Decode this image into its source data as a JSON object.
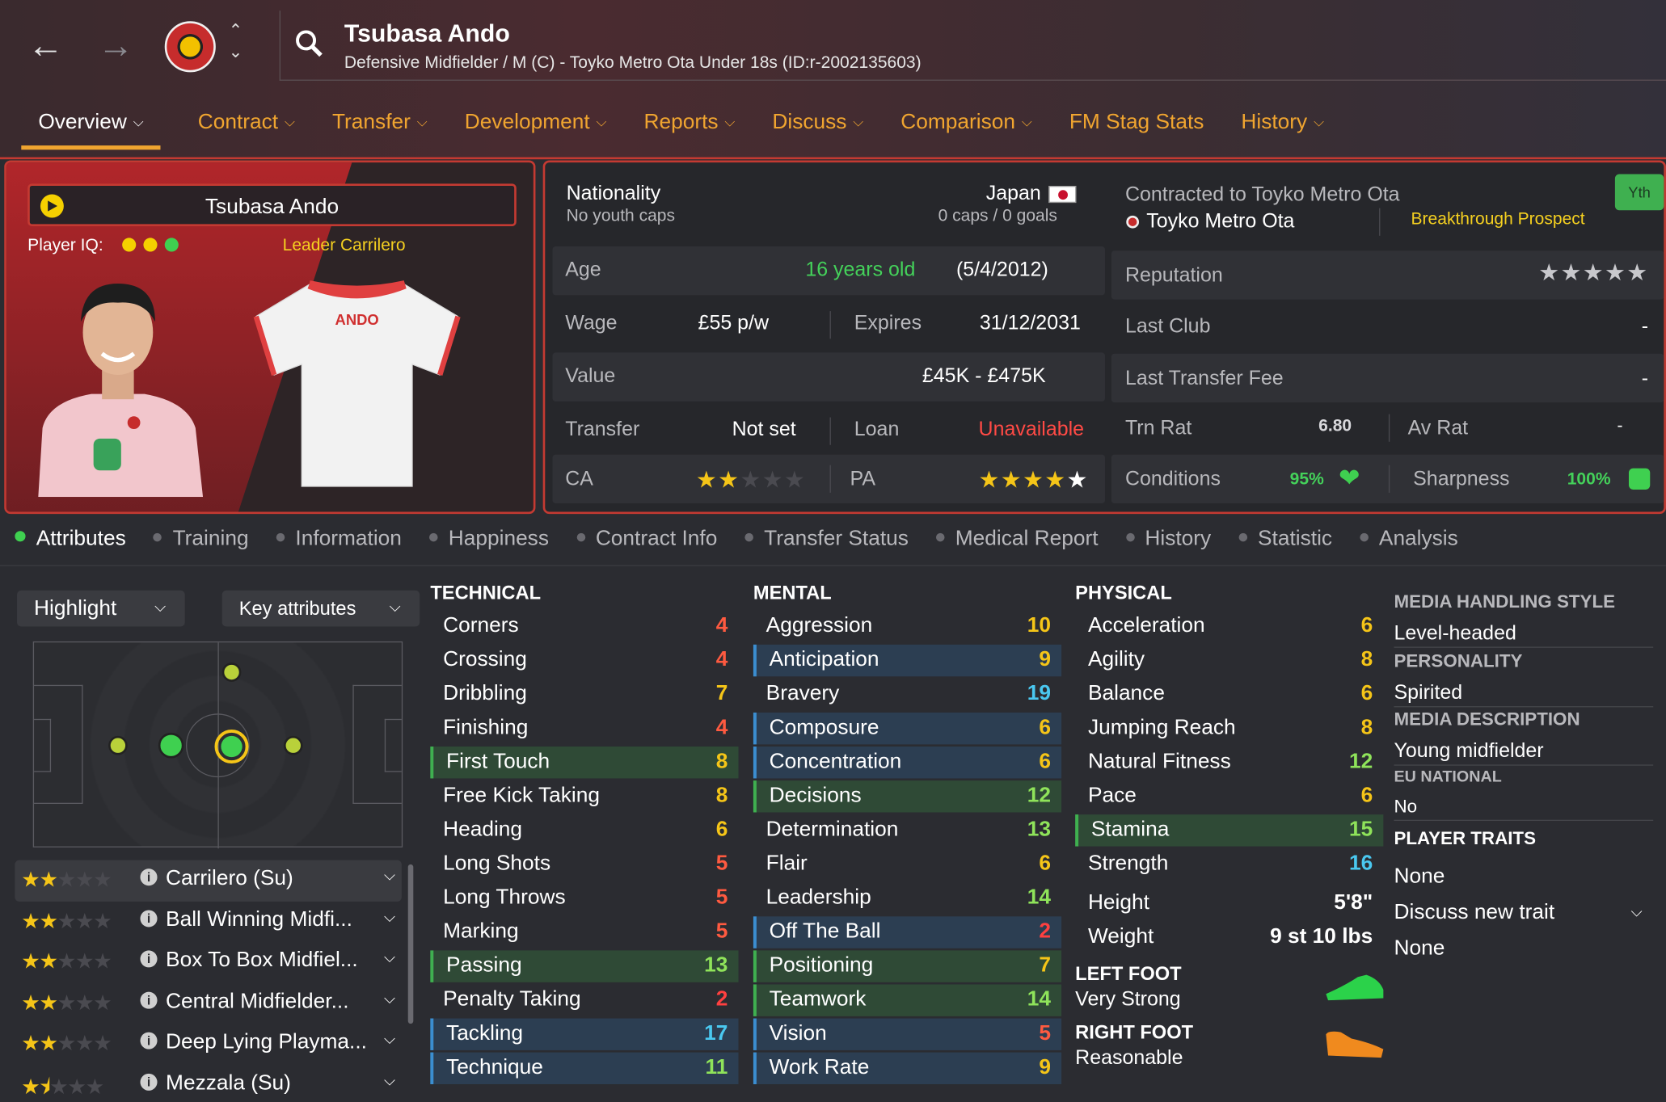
{
  "header": {
    "player_name": "Tsubasa Ando",
    "subtitle": "Defensive Midfielder / M (C) - Toyko Metro Ota Under 18s (ID:r-2002135603)"
  },
  "tabs": [
    {
      "label": "Overview"
    },
    {
      "label": "Contract"
    },
    {
      "label": "Transfer"
    },
    {
      "label": "Development"
    },
    {
      "label": "Reports"
    },
    {
      "label": "Discuss"
    },
    {
      "label": "Comparison"
    },
    {
      "label": "FM Stag Stats"
    },
    {
      "label": "History"
    }
  ],
  "card": {
    "name": "Tsubasa Ando",
    "iq_label": "Player IQ:",
    "role_label": "Leader Carrilero",
    "shirt_name": "ANDO",
    "iq_dot_colors": [
      "#f5d000",
      "#f5d000",
      "#3fd050"
    ]
  },
  "info": {
    "nationality_label": "Nationality",
    "nationality": "Japan",
    "youth_caps": "No youth caps",
    "caps_goals": "0 caps / 0 goals",
    "age_label": "Age",
    "age": "16 years old",
    "dob": "(5/4/2012)",
    "wage_label": "Wage",
    "wage": "£55 p/w",
    "expires_label": "Expires",
    "expires": "31/12/2031",
    "value_label": "Value",
    "value": "£45K - £475K",
    "transfer_label": "Transfer",
    "transfer": "Not set",
    "loan_label": "Loan",
    "loan": "Unavailable",
    "ca_label": "CA",
    "ca_stars": 2,
    "pa_label": "PA",
    "pa_stars": 5,
    "contracted": "Contracted to Toyko Metro Ota",
    "club": "Toyko Metro Ota",
    "prospect": "Breakthrough Prospect",
    "badge": "Yth",
    "reputation_label": "Reputation",
    "reputation_stars": 5,
    "last_club_label": "Last Club",
    "last_club": "-",
    "last_fee_label": "Last Transfer Fee",
    "last_fee": "-",
    "trn_label": "Trn Rat",
    "trn": "6.80",
    "av_label": "Av Rat",
    "av": "-",
    "conditions_label": "Conditions",
    "conditions": "95%",
    "sharpness_label": "Sharpness",
    "sharpness": "100%"
  },
  "subtabs": [
    {
      "label": "Attributes"
    },
    {
      "label": "Training"
    },
    {
      "label": "Information"
    },
    {
      "label": "Happiness"
    },
    {
      "label": "Contract Info"
    },
    {
      "label": "Transfer Status"
    },
    {
      "label": "Medical Report"
    },
    {
      "label": "History"
    },
    {
      "label": "Statistic"
    },
    {
      "label": "Analysis"
    }
  ],
  "left": {
    "highlight": "Highlight",
    "key_attrs": "Key attributes",
    "roles": [
      {
        "name": "Carrilero (Su)",
        "stars": 2
      },
      {
        "name": "Ball Winning Midfi...",
        "stars": 2
      },
      {
        "name": "Box To Box Midfiel...",
        "stars": 2
      },
      {
        "name": "Central Midfielder...",
        "stars": 2
      },
      {
        "name": "Deep Lying Playma...",
        "stars": 2
      },
      {
        "name": "Mezzala (Su)",
        "stars": 1.5
      }
    ]
  },
  "attributes": {
    "technical_title": "TECHNICAL",
    "technical": [
      {
        "n": "Corners",
        "v": "4"
      },
      {
        "n": "Crossing",
        "v": "4"
      },
      {
        "n": "Dribbling",
        "v": "7"
      },
      {
        "n": "Finishing",
        "v": "4"
      },
      {
        "n": "First Touch",
        "v": "8",
        "h": "g"
      },
      {
        "n": "Free Kick Taking",
        "v": "8"
      },
      {
        "n": "Heading",
        "v": "6"
      },
      {
        "n": "Long Shots",
        "v": "5"
      },
      {
        "n": "Long Throws",
        "v": "5"
      },
      {
        "n": "Marking",
        "v": "5"
      },
      {
        "n": "Passing",
        "v": "13",
        "h": "g"
      },
      {
        "n": "Penalty Taking",
        "v": "2"
      },
      {
        "n": "Tackling",
        "v": "17",
        "h": "b"
      },
      {
        "n": "Technique",
        "v": "11",
        "h": "b"
      }
    ],
    "mental_title": "MENTAL",
    "mental": [
      {
        "n": "Aggression",
        "v": "10"
      },
      {
        "n": "Anticipation",
        "v": "9",
        "h": "b"
      },
      {
        "n": "Bravery",
        "v": "19"
      },
      {
        "n": "Composure",
        "v": "6",
        "h": "b"
      },
      {
        "n": "Concentration",
        "v": "6",
        "h": "b"
      },
      {
        "n": "Decisions",
        "v": "12",
        "h": "g"
      },
      {
        "n": "Determination",
        "v": "13"
      },
      {
        "n": "Flair",
        "v": "6"
      },
      {
        "n": "Leadership",
        "v": "14"
      },
      {
        "n": "Off The Ball",
        "v": "2",
        "h": "b"
      },
      {
        "n": "Positioning",
        "v": "7",
        "h": "g"
      },
      {
        "n": "Teamwork",
        "v": "14",
        "h": "g"
      },
      {
        "n": "Vision",
        "v": "5",
        "h": "b"
      },
      {
        "n": "Work Rate",
        "v": "9",
        "h": "b"
      }
    ],
    "physical_title": "PHYSICAL",
    "physical": [
      {
        "n": "Acceleration",
        "v": "6"
      },
      {
        "n": "Agility",
        "v": "8"
      },
      {
        "n": "Balance",
        "v": "6"
      },
      {
        "n": "Jumping Reach",
        "v": "8"
      },
      {
        "n": "Natural Fitness",
        "v": "12"
      },
      {
        "n": "Pace",
        "v": "6"
      },
      {
        "n": "Stamina",
        "v": "15",
        "h": "g"
      },
      {
        "n": "Strength",
        "v": "16"
      }
    ],
    "height_label": "Height",
    "height": "5'8\"",
    "weight_label": "Weight",
    "weight": "9 st 10 lbs",
    "left_foot_label": "LEFT FOOT",
    "left_foot": "Very Strong",
    "right_foot_label": "RIGHT FOOT",
    "right_foot": "Reasonable"
  },
  "side": {
    "mhs_label": "MEDIA HANDLING STYLE",
    "mhs": "Level-headed",
    "personality_label": "PERSONALITY",
    "personality": "Spirited",
    "media_desc_label": "MEDIA DESCRIPTION",
    "media_desc": "Young midfielder",
    "eu_label": "EU NATIONAL",
    "eu": "No",
    "traits_label": "PLAYER TRAITS",
    "trait1": "None",
    "discuss": "Discuss new trait",
    "trait2": "None"
  }
}
